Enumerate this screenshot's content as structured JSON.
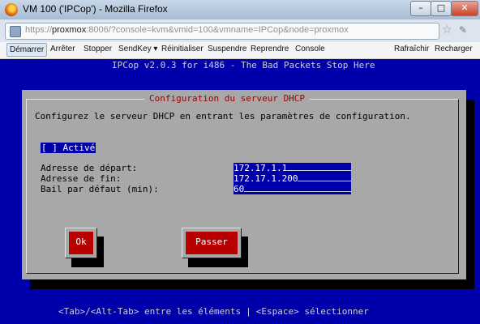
{
  "window": {
    "title": "VM 100 ('IPCop') - Mozilla Firefox",
    "minimize_glyph": "–",
    "maximize_glyph": "□",
    "close_glyph": "✕"
  },
  "address_bar": {
    "url_prefix": "https://",
    "url_host": "proxmox",
    "url_rest": ":8006/?console=kvm&vmid=100&vmname=IPCop&node=proxmox"
  },
  "toolbar": {
    "start": "Démarrer",
    "stop_shutdown": "Arrêter",
    "stop": "Stopper",
    "sendkey": "SendKey ▾",
    "reset": "Réinitialiser",
    "suspend": "Suspendre",
    "resume": "Reprendre",
    "console": "Console",
    "refresh": "Rafraîchir",
    "reload": "Recharger"
  },
  "console": {
    "header": "IPCop v2.0.3 for i486 - The Bad Packets Stop Here",
    "dialog": {
      "title": "Configuration du serveur DHCP",
      "intro": "Configurez le serveur DHCP en entrant les paramètres de configuration.",
      "checkbox": "[ ] Activé",
      "fields": [
        {
          "label": "Adresse de départ:",
          "value": "172.17.1.1"
        },
        {
          "label": "Adresse de fin:",
          "value": "172.17.1.200"
        },
        {
          "label": "Bail par défaut (min):",
          "value": "60"
        }
      ],
      "ok_button": "Ok",
      "skip_button": "Passer"
    },
    "footer_left": "<Tab>/<Alt-Tab> entre les éléments",
    "footer_sep": "|",
    "footer_right": "<Espace> sélectionner"
  },
  "colors": {
    "console_bg": "#0000aa",
    "dialog_bg": "#a8a8a8",
    "accent_red": "#b80000"
  }
}
